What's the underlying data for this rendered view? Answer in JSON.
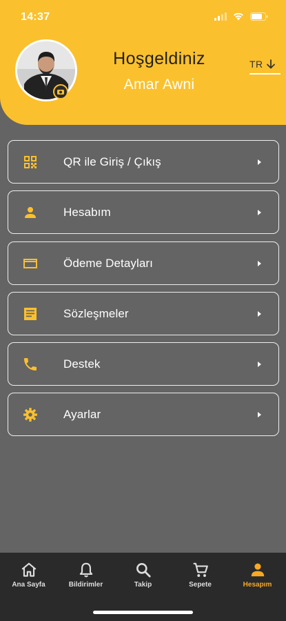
{
  "status": {
    "time": "14:37"
  },
  "header": {
    "welcome": "Hoşgeldiniz",
    "user_name": "Amar Awni",
    "language": "TR"
  },
  "colors": {
    "accent": "#FBC02D",
    "active_tab": "#F9A825",
    "background": "#646464",
    "tabbar": "#2a2a2a"
  },
  "menu": [
    {
      "label": "QR ile Giriş / Çıkış",
      "icon": "qr-code-icon"
    },
    {
      "label": "Hesabım",
      "icon": "person-icon"
    },
    {
      "label": "Ödeme Detayları",
      "icon": "credit-card-icon"
    },
    {
      "label": "Sözleşmeler",
      "icon": "document-icon"
    },
    {
      "label": "Destek",
      "icon": "phone-icon"
    },
    {
      "label": "Ayarlar",
      "icon": "gear-icon"
    }
  ],
  "tabs": [
    {
      "label": "Ana Sayfa",
      "icon": "home-icon",
      "active": false
    },
    {
      "label": "Bildirimler",
      "icon": "bell-icon",
      "active": false
    },
    {
      "label": "Takip",
      "icon": "search-icon",
      "active": false
    },
    {
      "label": "Sepete",
      "icon": "cart-icon",
      "active": false
    },
    {
      "label": "Hesapım",
      "icon": "person-icon",
      "active": true
    }
  ]
}
